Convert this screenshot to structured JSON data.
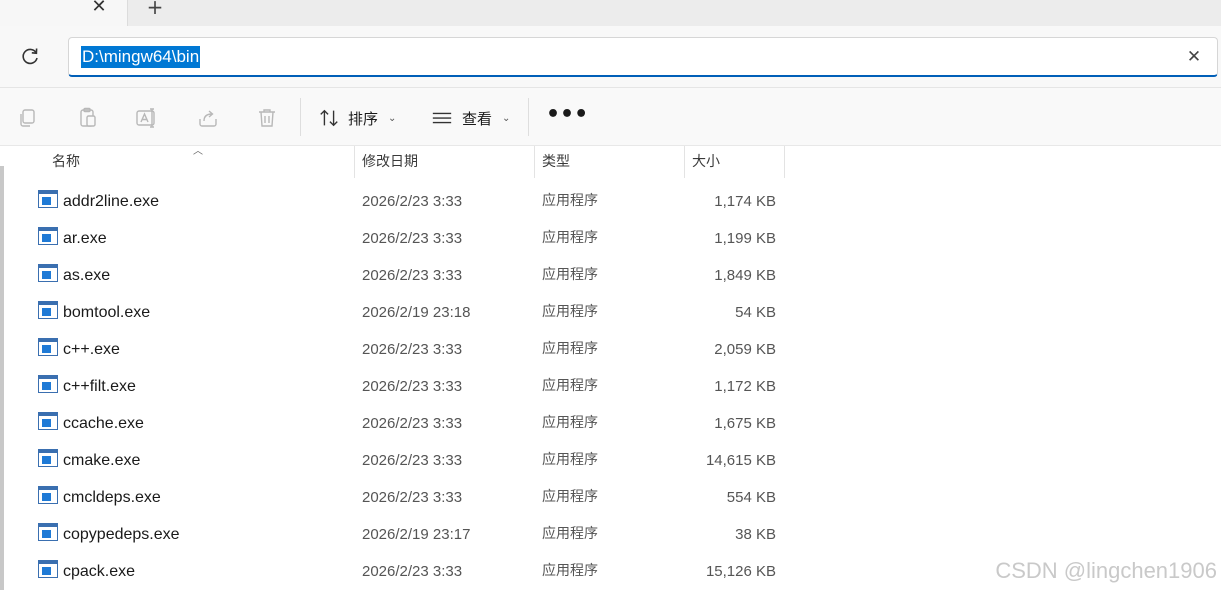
{
  "tabs": {
    "close_glyph": "✕",
    "new_glyph": "+"
  },
  "address": {
    "path": "D:\\mingw64\\bin",
    "clear_glyph": "✕"
  },
  "toolbar": {
    "sort_label": "排序",
    "view_label": "查看",
    "more_label": "•••"
  },
  "columns": {
    "name": "名称",
    "date": "修改日期",
    "type": "类型",
    "size": "大小"
  },
  "files": [
    {
      "name": "addr2line.exe",
      "date": "2026/2/23 3:33",
      "type": "应用程序",
      "size": "1,174 KB"
    },
    {
      "name": "ar.exe",
      "date": "2026/2/23 3:33",
      "type": "应用程序",
      "size": "1,199 KB"
    },
    {
      "name": "as.exe",
      "date": "2026/2/23 3:33",
      "type": "应用程序",
      "size": "1,849 KB"
    },
    {
      "name": "bomtool.exe",
      "date": "2026/2/19 23:18",
      "type": "应用程序",
      "size": "54 KB"
    },
    {
      "name": "c++.exe",
      "date": "2026/2/23 3:33",
      "type": "应用程序",
      "size": "2,059 KB"
    },
    {
      "name": "c++filt.exe",
      "date": "2026/2/23 3:33",
      "type": "应用程序",
      "size": "1,172 KB"
    },
    {
      "name": "ccache.exe",
      "date": "2026/2/23 3:33",
      "type": "应用程序",
      "size": "1,675 KB"
    },
    {
      "name": "cmake.exe",
      "date": "2026/2/23 3:33",
      "type": "应用程序",
      "size": "14,615 KB"
    },
    {
      "name": "cmcldeps.exe",
      "date": "2026/2/23 3:33",
      "type": "应用程序",
      "size": "554 KB"
    },
    {
      "name": "copypedeps.exe",
      "date": "2026/2/19 23:17",
      "type": "应用程序",
      "size": "38 KB"
    },
    {
      "name": "cpack.exe",
      "date": "2026/2/23 3:33",
      "type": "应用程序",
      "size": "15,126 KB"
    }
  ],
  "watermark": "CSDN @lingchen1906",
  "colors": {
    "accent": "#0078d4",
    "selection": "#0078d4"
  }
}
